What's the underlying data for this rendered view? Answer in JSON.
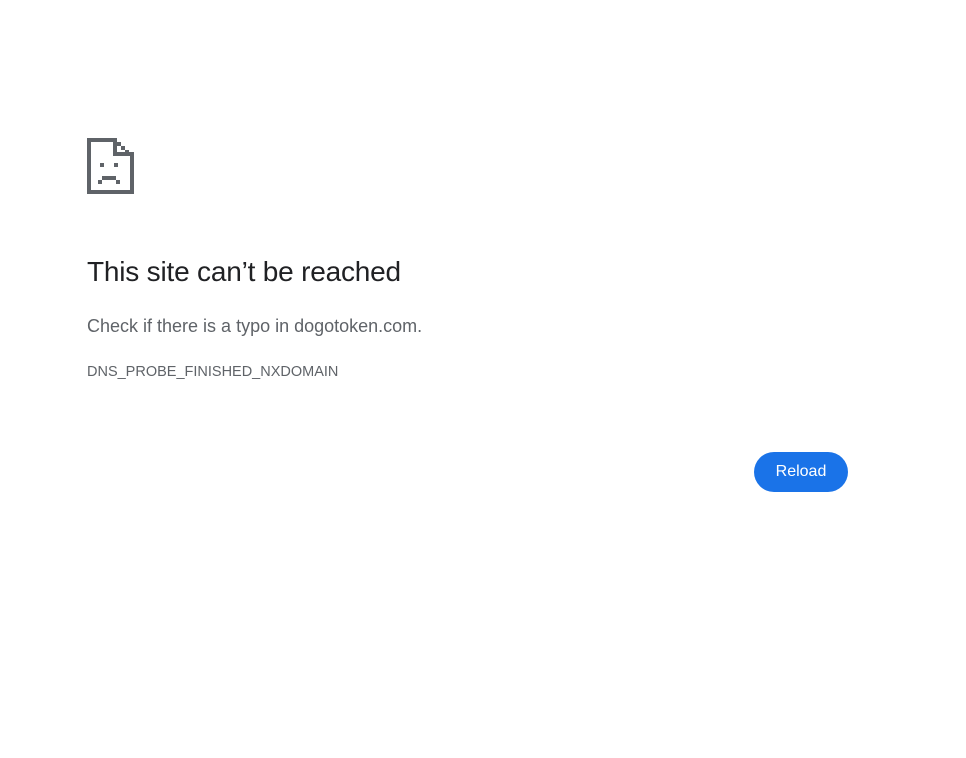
{
  "error_page": {
    "icon": "sad-document-icon",
    "title": "This site can’t be reached",
    "message": "Check if there is a typo in dogotoken.com.",
    "error_code": "DNS_PROBE_FINISHED_NXDOMAIN",
    "reload_label": "Reload"
  },
  "colors": {
    "background": "#ffffff",
    "title": "#202124",
    "secondary_text": "#5f6368",
    "icon": "#5f6368",
    "button_background": "#1a73e8",
    "button_text": "#ffffff"
  }
}
